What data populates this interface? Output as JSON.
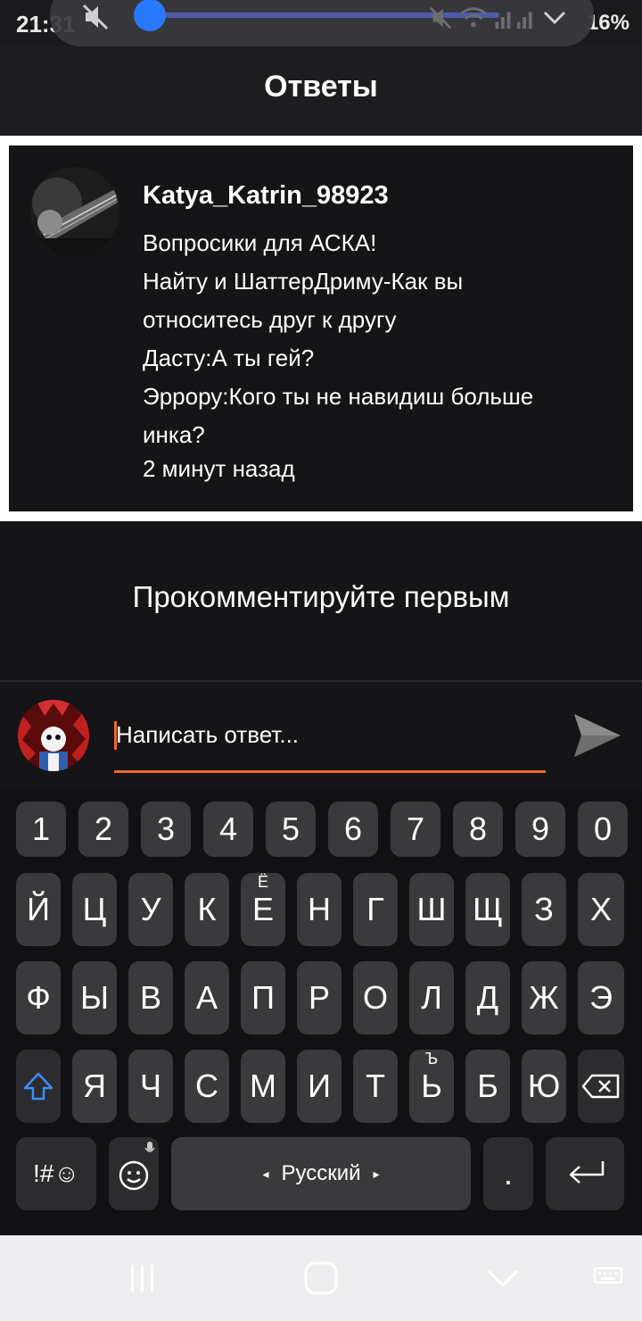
{
  "status_bar": {
    "time": "21:31",
    "battery": "16%"
  },
  "header": {
    "title": "Ответы"
  },
  "question": {
    "username": "Katya_Katrin_98923",
    "lines": [
      "Вопросики для АСКА!",
      "Найту и ШаттерДриму-Как вы",
      "относитесь друг к другу",
      "Дасту:А ты гей?",
      "Эррору:Кого ты не навидиш больше",
      "инка?"
    ],
    "time": "2 минут назад"
  },
  "comments": {
    "empty_text": "Прокомментируйте первым"
  },
  "reply": {
    "placeholder": "Написать ответ..."
  },
  "keyboard": {
    "number_row": [
      "1",
      "2",
      "3",
      "4",
      "5",
      "6",
      "7",
      "8",
      "9",
      "0"
    ],
    "row1": [
      "Й",
      "Ц",
      "У",
      "К",
      "Е",
      "Н",
      "Г",
      "Ш",
      "Щ",
      "З",
      "Х"
    ],
    "row1_sup_e": "Ё",
    "row2": [
      "Ф",
      "Ы",
      "В",
      "А",
      "П",
      "Р",
      "О",
      "Л",
      "Д",
      "Ж",
      "Э"
    ],
    "row3": [
      "Я",
      "Ч",
      "С",
      "М",
      "И",
      "Т",
      "Ь",
      "Б",
      "Ю"
    ],
    "row3_sup_soft": "Ъ",
    "symbols_label": "!#☺",
    "space_label": "Русский",
    "period_label": ".",
    "accent_color": "#f06a2c",
    "shift_color": "#3b8cff"
  }
}
